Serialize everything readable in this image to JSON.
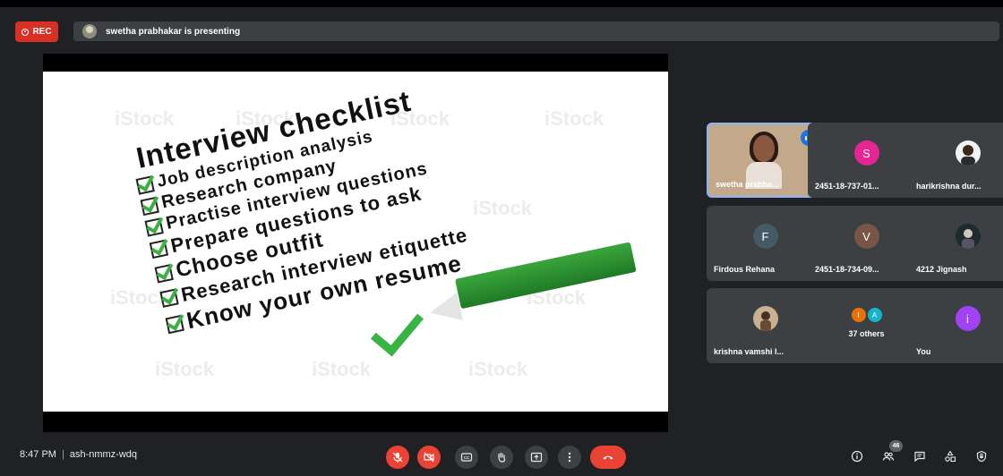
{
  "recording": {
    "label": "REC",
    "color": "#d93025"
  },
  "presentation": {
    "banner_text": "swetha prabhakar is presenting"
  },
  "slide": {
    "title": "Interview checklist",
    "items": [
      "Job description analysis",
      "Research company",
      "Practise interview questions",
      "Prepare questions to ask",
      "Choose outfit",
      "Research interview etiquette",
      "Know your own resume"
    ],
    "watermark": "iStock"
  },
  "participants": [
    {
      "name": "swetha prabha...",
      "avatar": "photo",
      "speaking": true
    },
    {
      "name": "2451-18-737-01...",
      "initial": "S",
      "color": "#e52592",
      "muted": true
    },
    {
      "name": "harikrishna dur...",
      "avatar": "photo",
      "muted": true
    },
    {
      "name": "Firdous Rehana",
      "initial": "F",
      "color": "#455a64",
      "muted": true
    },
    {
      "name": "2451-18-734-09...",
      "initial": "V",
      "color": "#795548",
      "muted": true
    },
    {
      "name": "4212 Jignash",
      "avatar": "photo",
      "muted": true
    },
    {
      "name": "krishna vamshi l...",
      "avatar": "photo",
      "muted": true
    },
    {
      "name": "37 others",
      "initials": [
        "I",
        "A"
      ],
      "colors": [
        "#e8710a",
        "#12b5cb"
      ]
    },
    {
      "name": "You",
      "initial": "i",
      "color": "#a142f4",
      "muted": true
    }
  ],
  "meeting": {
    "time": "8:47 PM",
    "code": "ash-nmmz-wdq"
  },
  "controls": {
    "mic": "mic-off-icon",
    "camera": "camera-off-icon",
    "captions": "captions-icon",
    "raise_hand": "hand-icon",
    "present": "present-icon",
    "more": "more-options-icon",
    "leave": "end-call-icon"
  },
  "right_controls": {
    "people_count": "46"
  }
}
